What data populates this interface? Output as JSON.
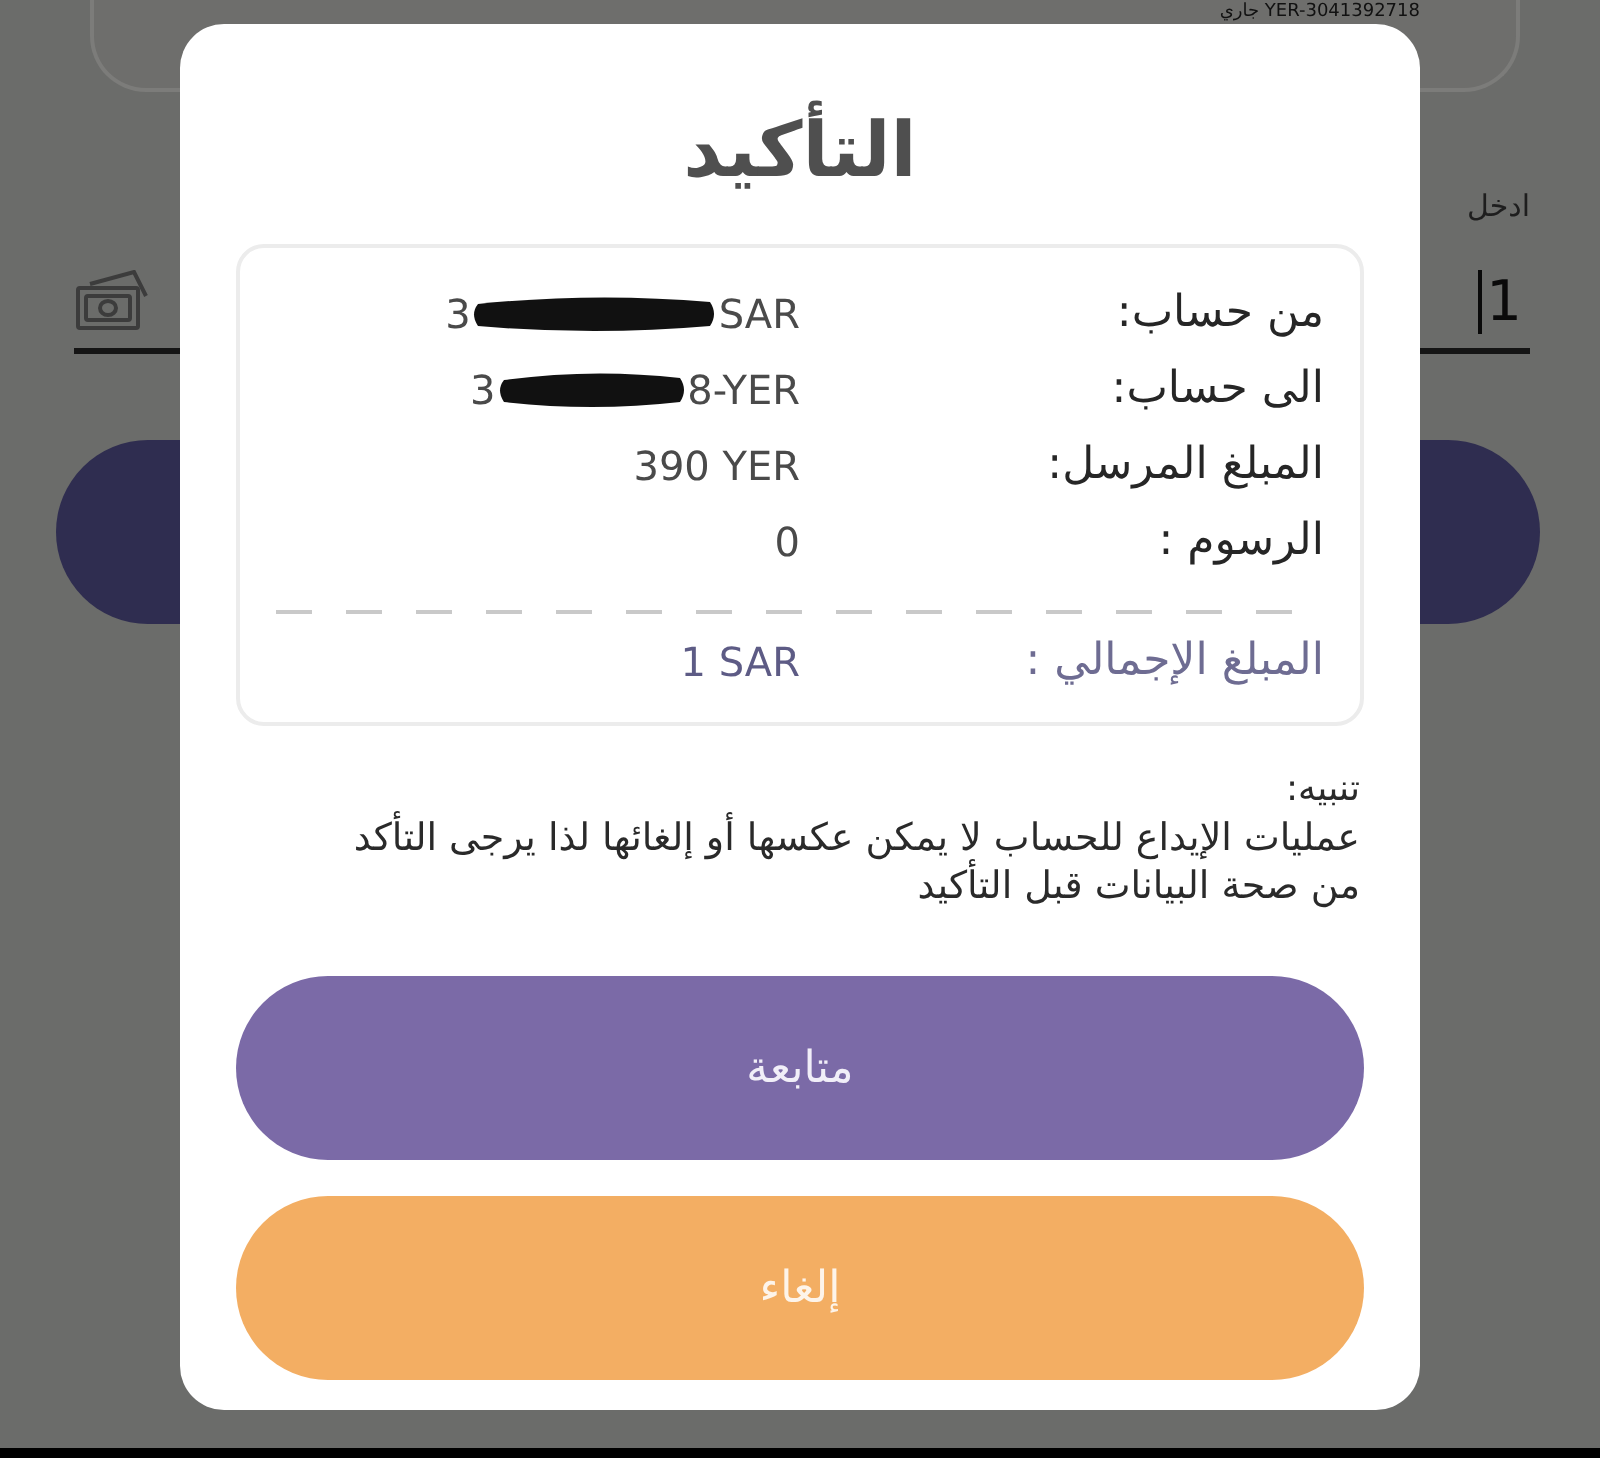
{
  "background": {
    "account_card": {
      "text": "جاري YER-3041392718"
    },
    "amount_field": {
      "label": "ادخل",
      "value": "1"
    }
  },
  "dialog": {
    "title": "التأكيد",
    "summary": {
      "rows": [
        {
          "label": "من حساب:",
          "value_start": "3",
          "value_end": "SAR",
          "redacted": true
        },
        {
          "label": "الى حساب:",
          "value_start": "3",
          "value_end": "8-YER",
          "redacted": true
        },
        {
          "label": "المبلغ المرسل:",
          "value": "390 YER"
        },
        {
          "label": "الرسوم :",
          "value": "0"
        }
      ],
      "total": {
        "label": "المبلغ الإجمالي :",
        "value": "1 SAR"
      }
    },
    "notice": {
      "heading": "تنبيه:",
      "text": "عمليات الإيداع للحساب لا يمكن عكسها أو إلغائها لذا يرجى التأكد من صحة البيانات قبل التأكيد"
    },
    "buttons": [
      {
        "label": "متابعة",
        "kind": "primary"
      },
      {
        "label": "إلغاء",
        "kind": "cancel"
      }
    ]
  }
}
